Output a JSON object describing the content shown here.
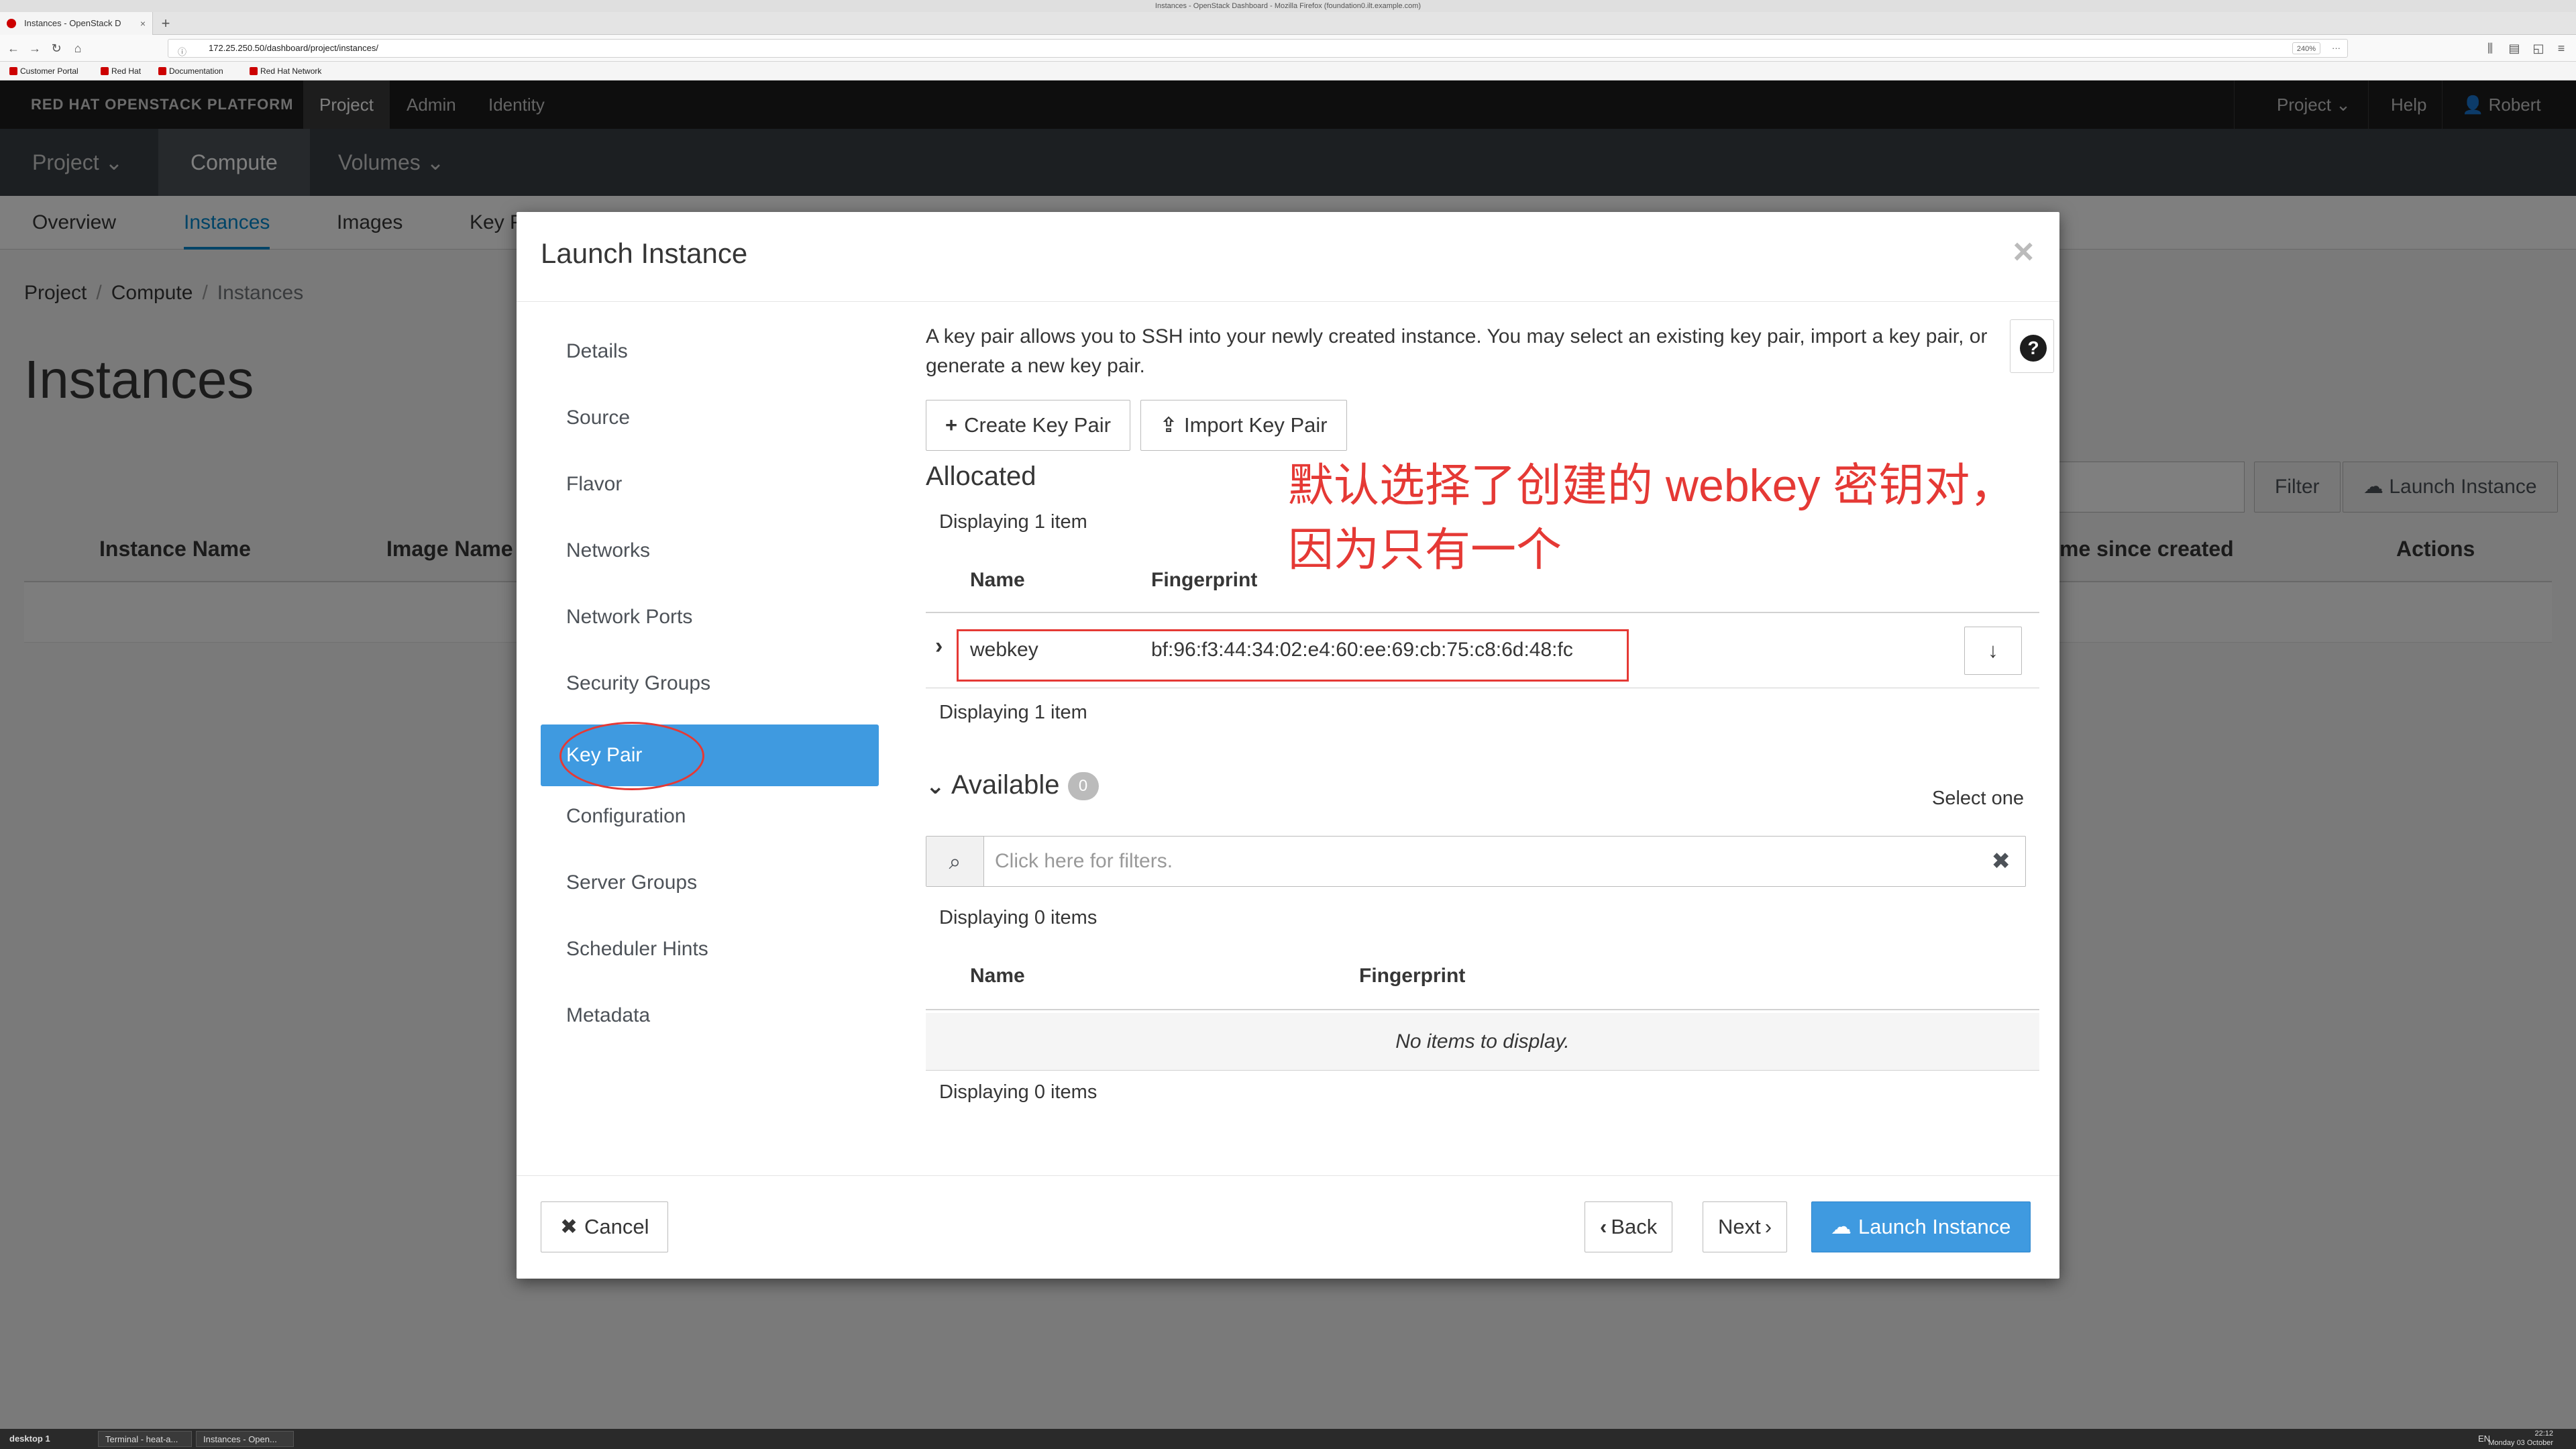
{
  "browser": {
    "window_title": "Instances - OpenStack Dashboard - Mozilla Firefox (foundation0.ilt.example.com)",
    "tab_title": "Instances - OpenStack D",
    "url": "172.25.250.50/dashboard/project/instances/",
    "zoom": "240%",
    "bookmarks": [
      "Customer Portal",
      "Red Hat",
      "Documentation",
      "Red Hat Network"
    ]
  },
  "topnav": {
    "brand": "RED HAT OPENSTACK PLATFORM",
    "items": [
      "Project",
      "Admin",
      "Identity"
    ],
    "right": {
      "project": "Project ⌄",
      "help": "Help",
      "user": "Robert ⌄"
    }
  },
  "subnav": [
    "Project ⌄",
    "Compute",
    "Volumes ⌄"
  ],
  "secnav": [
    "Overview",
    "Instances",
    "Images",
    "Key P"
  ],
  "breadcrumb": [
    "Project",
    "Compute",
    "Instances"
  ],
  "page_title": "Instances",
  "bg_actions": {
    "filter": "Filter",
    "launch": "Launch Instance"
  },
  "bg_table_headers": [
    "Instance Name",
    "Image Name",
    "me since created",
    "Actions"
  ],
  "modal": {
    "title": "Launch Instance",
    "close": "×",
    "wizard": [
      "Details",
      "Source",
      "Flavor",
      "Networks",
      "Network Ports",
      "Security Groups",
      "Key Pair",
      "Configuration",
      "Server Groups",
      "Scheduler Hints",
      "Metadata"
    ],
    "active_step": "Key Pair",
    "intro": "A key pair allows you to SSH into your newly created instance. You may select an existing key pair, import a key pair, or generate a new key pair.",
    "help": "?",
    "create_btn": "Create Key Pair",
    "import_btn": "Import Key Pair",
    "allocated": {
      "title": "Allocated",
      "count_top": "Displaying 1 item",
      "headers": [
        "Name",
        "Fingerprint"
      ],
      "rows": [
        {
          "name": "webkey",
          "fingerprint": "bf:96:f3:44:34:02:e4:60:ee:69:cb:75:c8:6d:48:fc"
        }
      ],
      "count_bottom": "Displaying 1 item"
    },
    "available": {
      "title": "Available",
      "badge": "0",
      "select_one": "Select one",
      "search_placeholder": "Click here for filters.",
      "count_top": "Displaying 0 items",
      "headers": [
        "Name",
        "Fingerprint"
      ],
      "empty": "No items to display.",
      "count_bottom": "Displaying 0 items"
    },
    "footer": {
      "cancel": "Cancel",
      "back": "Back",
      "next": "Next",
      "launch": "Launch Instance"
    }
  },
  "annotation": "默认选择了创建的 webkey 密钥对，因为只有一个",
  "taskbar": {
    "items": [
      "desktop 1",
      "Terminal - heat-a...",
      "Instances - Open..."
    ],
    "tray": "EN",
    "time": "22:12",
    "date": "Monday 03 October"
  },
  "colors": {
    "accent": "#3f9ae0",
    "annotation": "#e53935",
    "link": "#0088ce"
  }
}
